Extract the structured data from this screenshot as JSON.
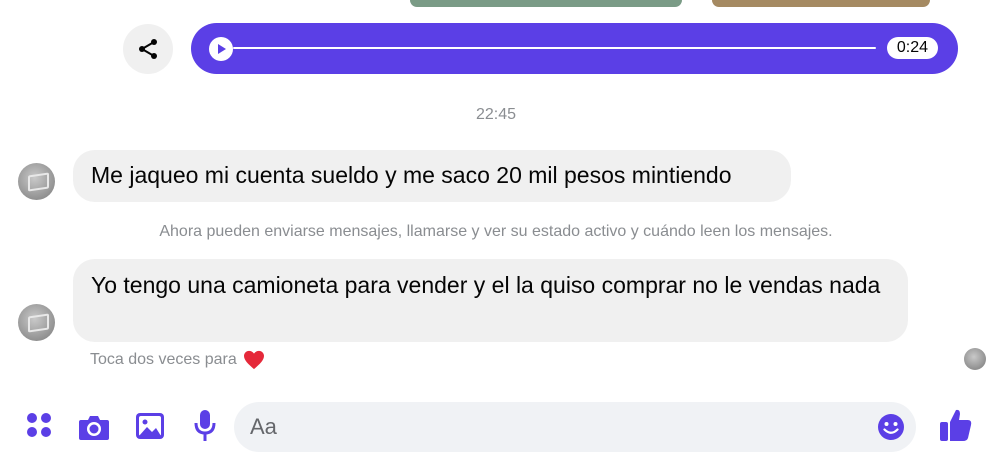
{
  "audio": {
    "duration": "0:24",
    "progress": 0
  },
  "timestamp": "22:45",
  "messages": [
    {
      "text": "Me jaqueo mi cuenta sueldo y me saco 20 mil pesos mintiendo"
    },
    {
      "text": "Yo tengo una camioneta para vender y el la quiso comprar no  le vendas nada"
    }
  ],
  "system_note": "Ahora pueden enviarse mensajes, llamarse y ver su estado activo y cuándo leen los mensajes.",
  "reaction_hint": {
    "text": "Toca dos veces para",
    "icon": "heart-icon"
  },
  "composer": {
    "placeholder": "Aa"
  },
  "colors": {
    "accent": "#5b3fe6",
    "bubble": "#f0f0f0",
    "muted": "#8a8d91",
    "heart": "#e5293a"
  },
  "icons": [
    "share-icon",
    "play-icon",
    "apps-icon",
    "camera-icon",
    "gallery-icon",
    "microphone-icon",
    "emoji-icon",
    "like-icon"
  ]
}
